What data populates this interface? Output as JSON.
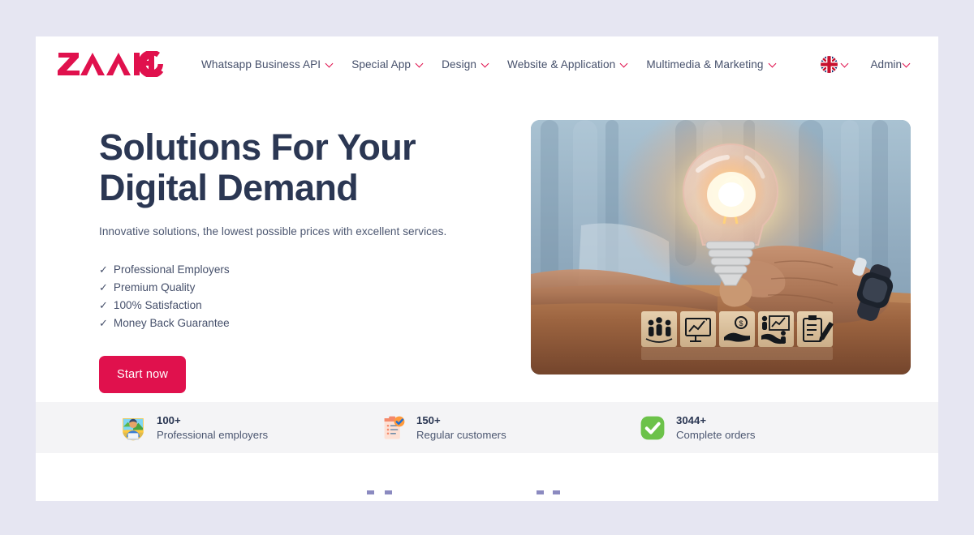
{
  "brand": {
    "name": "ZAAHO",
    "color": "#e0114d"
  },
  "header": {
    "nav_items": [
      {
        "label": "Whatsapp Business API",
        "icon": "chevron-down-icon"
      },
      {
        "label": "Special App",
        "icon": "chevron-down-icon"
      },
      {
        "label": "Design",
        "icon": "chevron-down-icon"
      },
      {
        "label": "Website & Application",
        "icon": "chevron-down-icon"
      },
      {
        "label": "Multimedia & Marketing",
        "icon": "chevron-down-icon"
      }
    ],
    "language": {
      "icon": "uk-flag-icon",
      "chevron": "chevron-down-icon"
    },
    "account": {
      "label": "Admin",
      "chevron": "chevron-down-icon"
    }
  },
  "hero": {
    "title_line_1": "Solutions For Your",
    "title_line_2": "Digital Demand",
    "subtitle": "Innovative solutions, the lowest possible prices with excellent services.",
    "features": [
      {
        "tick": "✓",
        "label": "Professional Employers"
      },
      {
        "tick": "✓",
        "label": "Premium Quality"
      },
      {
        "tick": "✓",
        "label": "100% Satisfaction"
      },
      {
        "tick": "✓",
        "label": "Money Back Guarantee"
      }
    ],
    "cta_label": "Start now",
    "image_alt": "person holding a glowing lightbulb above wooden business icon blocks"
  },
  "stats": [
    {
      "icon": "professional-employers-icon",
      "value": "100+",
      "label": "Professional employers"
    },
    {
      "icon": "clipboard-check-icon",
      "value": "150+",
      "label": "Regular customers"
    },
    {
      "icon": "green-check-icon",
      "value": "3044+",
      "label": "Complete orders"
    }
  ],
  "colors": {
    "page_background": "#e6e6f2",
    "card_background": "#ffffff",
    "stats_band": "#f4f4f6",
    "heading": "#2b3753",
    "body_text": "#46506b",
    "accent": "#e0114d"
  }
}
